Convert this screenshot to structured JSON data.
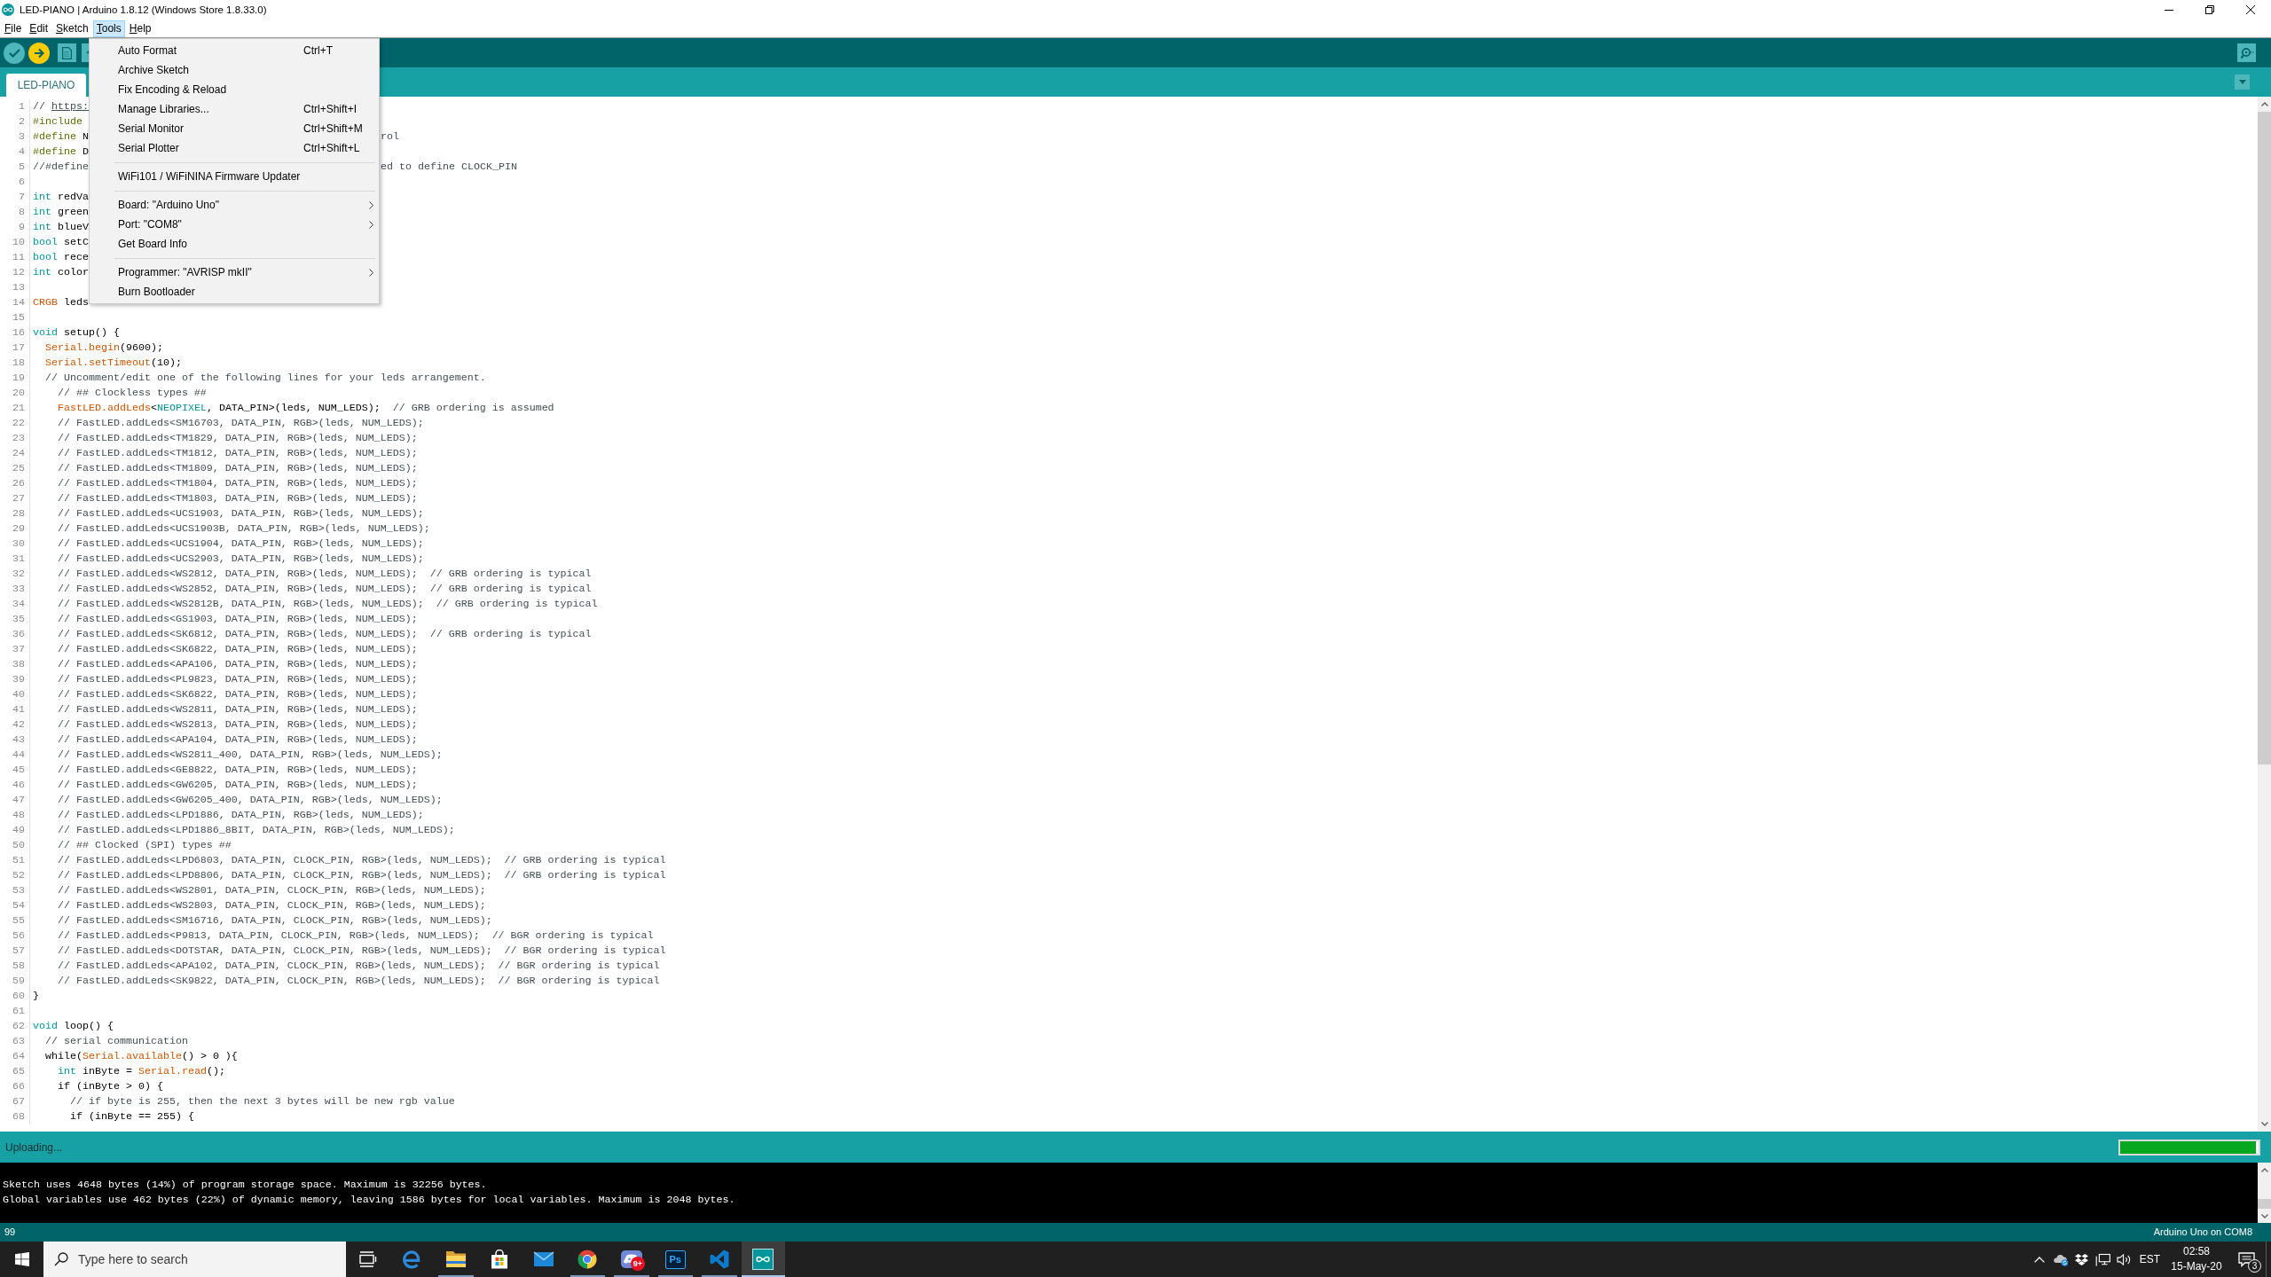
{
  "window": {
    "title": "LED-PIANO | Arduino 1.8.12 (Windows Store 1.8.33.0)"
  },
  "menu_bar": [
    {
      "label": "File",
      "selected": false
    },
    {
      "label": "Edit",
      "selected": false
    },
    {
      "label": "Sketch",
      "selected": false
    },
    {
      "label": "Tools",
      "selected": true
    },
    {
      "label": "Help",
      "selected": false
    }
  ],
  "tools_menu": {
    "items": [
      {
        "kind": "item",
        "label": "Auto Format",
        "shortcut": "Ctrl+T"
      },
      {
        "kind": "item",
        "label": "Archive Sketch"
      },
      {
        "kind": "item",
        "label": "Fix Encoding & Reload"
      },
      {
        "kind": "item",
        "label": "Manage Libraries...",
        "shortcut": "Ctrl+Shift+I"
      },
      {
        "kind": "item",
        "label": "Serial Monitor",
        "shortcut": "Ctrl+Shift+M"
      },
      {
        "kind": "item",
        "label": "Serial Plotter",
        "shortcut": "Ctrl+Shift+L"
      },
      {
        "kind": "separator"
      },
      {
        "kind": "item",
        "label": "WiFi101 / WiFiNINA Firmware Updater"
      },
      {
        "kind": "separator"
      },
      {
        "kind": "submenu",
        "label": "Board: \"Arduino Uno\""
      },
      {
        "kind": "submenu",
        "label": "Port: \"COM8\""
      },
      {
        "kind": "item",
        "label": "Get Board Info"
      },
      {
        "kind": "separator"
      },
      {
        "kind": "submenu",
        "label": "Programmer: \"AVRISP mkII\""
      },
      {
        "kind": "item",
        "label": "Burn Bootloader"
      }
    ]
  },
  "tabs": [
    {
      "label": "LED-PIANO",
      "selected": true
    }
  ],
  "editor": {
    "lines": [
      {
        "number": "1",
        "code": [
          {
            "kind": "comment",
            "text": "// "
          },
          {
            "kind": "link",
            "text": "https:"
          }
        ]
      },
      {
        "number": "2",
        "code": [
          {
            "kind": "preprocessor",
            "text": "#include"
          }
        ]
      },
      {
        "number": "3",
        "code": [
          {
            "kind": "preprocessor",
            "text": "#define"
          },
          {
            "kind": "plain",
            "text": " N"
          }
        ],
        "code_after_menu": [
          {
            "kind": "comment",
            "text": "rol"
          }
        ]
      },
      {
        "number": "4",
        "code": [
          {
            "kind": "preprocessor",
            "text": "#define"
          },
          {
            "kind": "plain",
            "text": " D"
          }
        ]
      },
      {
        "number": "5",
        "code": [
          {
            "kind": "comment",
            "text": "//#define"
          }
        ],
        "code_after_menu": [
          {
            "kind": "comment",
            "text": "ed to define CLOCK_PIN"
          }
        ]
      },
      {
        "number": "6"
      },
      {
        "number": "7",
        "code": [
          {
            "kind": "keyword",
            "text": "int"
          },
          {
            "kind": "plain",
            "text": " redVa"
          }
        ]
      },
      {
        "number": "8",
        "code": [
          {
            "kind": "keyword",
            "text": "int"
          },
          {
            "kind": "plain",
            "text": " green"
          }
        ]
      },
      {
        "number": "9",
        "code": [
          {
            "kind": "keyword",
            "text": "int"
          },
          {
            "kind": "plain",
            "text": " blueV"
          }
        ]
      },
      {
        "number": "10",
        "code": [
          {
            "kind": "keyword",
            "text": "bool"
          },
          {
            "kind": "plain",
            "text": " setC"
          }
        ]
      },
      {
        "number": "11",
        "code": [
          {
            "kind": "keyword",
            "text": "bool"
          },
          {
            "kind": "plain",
            "text": " rece"
          }
        ]
      },
      {
        "number": "12",
        "code": [
          {
            "kind": "keyword",
            "text": "int"
          },
          {
            "kind": "plain",
            "text": " color"
          }
        ]
      },
      {
        "number": "13"
      },
      {
        "number": "14",
        "code": [
          {
            "kind": "builtin",
            "text": "CRGB"
          },
          {
            "kind": "plain",
            "text": " leds"
          }
        ]
      },
      {
        "number": "15"
      },
      {
        "number": "16",
        "code": [
          {
            "kind": "keyword",
            "text": "void"
          },
          {
            "kind": "plain",
            "text": " setup() {"
          }
        ]
      },
      {
        "number": "17",
        "code": [
          {
            "kind": "builtin",
            "text": "  Serial.begin"
          },
          {
            "kind": "plain",
            "text": "(9600);"
          }
        ]
      },
      {
        "number": "18",
        "code": [
          {
            "kind": "builtin",
            "text": "  Serial.setTimeout"
          },
          {
            "kind": "plain",
            "text": "(10);"
          }
        ]
      },
      {
        "number": "19",
        "code": [
          {
            "kind": "comment",
            "text": "  // Uncomment/edit one of the following lines for your leds arrangement."
          }
        ]
      },
      {
        "number": "20",
        "code": [
          {
            "kind": "comment",
            "text": "    // ## Clockless types ##"
          }
        ]
      },
      {
        "number": "21",
        "code": [
          {
            "kind": "builtin",
            "text": "    FastLED.addLeds"
          },
          {
            "kind": "plain",
            "text": "<"
          },
          {
            "kind": "keyword",
            "text": "NEOPIXEL"
          },
          {
            "kind": "plain",
            "text": ", DATA_PIN>(leds, NUM_LEDS);  "
          },
          {
            "kind": "comment",
            "text": "// GRB ordering is assumed"
          }
        ]
      },
      {
        "number": "22",
        "code": [
          {
            "kind": "comment",
            "text": "    // FastLED.addLeds<SM16703, DATA_PIN, RGB>(leds, NUM_LEDS);"
          }
        ]
      },
      {
        "number": "23",
        "code": [
          {
            "kind": "comment",
            "text": "    // FastLED.addLeds<TM1829, DATA_PIN, RGB>(leds, NUM_LEDS);"
          }
        ]
      },
      {
        "number": "24",
        "code": [
          {
            "kind": "comment",
            "text": "    // FastLED.addLeds<TM1812, DATA_PIN, RGB>(leds, NUM_LEDS);"
          }
        ]
      },
      {
        "number": "25",
        "code": [
          {
            "kind": "comment",
            "text": "    // FastLED.addLeds<TM1809, DATA_PIN, RGB>(leds, NUM_LEDS);"
          }
        ]
      },
      {
        "number": "26",
        "code": [
          {
            "kind": "comment",
            "text": "    // FastLED.addLeds<TM1804, DATA_PIN, RGB>(leds, NUM_LEDS);"
          }
        ]
      },
      {
        "number": "27",
        "code": [
          {
            "kind": "comment",
            "text": "    // FastLED.addLeds<TM1803, DATA_PIN, RGB>(leds, NUM_LEDS);"
          }
        ]
      },
      {
        "number": "28",
        "code": [
          {
            "kind": "comment",
            "text": "    // FastLED.addLeds<UCS1903, DATA_PIN, RGB>(leds, NUM_LEDS);"
          }
        ]
      },
      {
        "number": "29",
        "code": [
          {
            "kind": "comment",
            "text": "    // FastLED.addLeds<UCS1903B, DATA_PIN, RGB>(leds, NUM_LEDS);"
          }
        ]
      },
      {
        "number": "30",
        "code": [
          {
            "kind": "comment",
            "text": "    // FastLED.addLeds<UCS1904, DATA_PIN, RGB>(leds, NUM_LEDS);"
          }
        ]
      },
      {
        "number": "31",
        "code": [
          {
            "kind": "comment",
            "text": "    // FastLED.addLeds<UCS2903, DATA_PIN, RGB>(leds, NUM_LEDS);"
          }
        ]
      },
      {
        "number": "32",
        "code": [
          {
            "kind": "comment",
            "text": "    // FastLED.addLeds<WS2812, DATA_PIN, RGB>(leds, NUM_LEDS);  // GRB ordering is typical"
          }
        ]
      },
      {
        "number": "33",
        "code": [
          {
            "kind": "comment",
            "text": "    // FastLED.addLeds<WS2852, DATA_PIN, RGB>(leds, NUM_LEDS);  // GRB ordering is typical"
          }
        ]
      },
      {
        "number": "34",
        "code": [
          {
            "kind": "comment",
            "text": "    // FastLED.addLeds<WS2812B, DATA_PIN, RGB>(leds, NUM_LEDS);  // GRB ordering is typical"
          }
        ]
      },
      {
        "number": "35",
        "code": [
          {
            "kind": "comment",
            "text": "    // FastLED.addLeds<GS1903, DATA_PIN, RGB>(leds, NUM_LEDS);"
          }
        ]
      },
      {
        "number": "36",
        "code": [
          {
            "kind": "comment",
            "text": "    // FastLED.addLeds<SK6812, DATA_PIN, RGB>(leds, NUM_LEDS);  // GRB ordering is typical"
          }
        ]
      },
      {
        "number": "37",
        "code": [
          {
            "kind": "comment",
            "text": "    // FastLED.addLeds<SK6822, DATA_PIN, RGB>(leds, NUM_LEDS);"
          }
        ]
      },
      {
        "number": "38",
        "code": [
          {
            "kind": "comment",
            "text": "    // FastLED.addLeds<APA106, DATA_PIN, RGB>(leds, NUM_LEDS);"
          }
        ]
      },
      {
        "number": "39",
        "code": [
          {
            "kind": "comment",
            "text": "    // FastLED.addLeds<PL9823, DATA_PIN, RGB>(leds, NUM_LEDS);"
          }
        ]
      },
      {
        "number": "40",
        "code": [
          {
            "kind": "comment",
            "text": "    // FastLED.addLeds<SK6822, DATA_PIN, RGB>(leds, NUM_LEDS);"
          }
        ]
      },
      {
        "number": "41",
        "code": [
          {
            "kind": "comment",
            "text": "    // FastLED.addLeds<WS2811, DATA_PIN, RGB>(leds, NUM_LEDS);"
          }
        ]
      },
      {
        "number": "42",
        "code": [
          {
            "kind": "comment",
            "text": "    // FastLED.addLeds<WS2813, DATA_PIN, RGB>(leds, NUM_LEDS);"
          }
        ]
      },
      {
        "number": "43",
        "code": [
          {
            "kind": "comment",
            "text": "    // FastLED.addLeds<APA104, DATA_PIN, RGB>(leds, NUM_LEDS);"
          }
        ]
      },
      {
        "number": "44",
        "code": [
          {
            "kind": "comment",
            "text": "    // FastLED.addLeds<WS2811_400, DATA_PIN, RGB>(leds, NUM_LEDS);"
          }
        ]
      },
      {
        "number": "45",
        "code": [
          {
            "kind": "comment",
            "text": "    // FastLED.addLeds<GE8822, DATA_PIN, RGB>(leds, NUM_LEDS);"
          }
        ]
      },
      {
        "number": "46",
        "code": [
          {
            "kind": "comment",
            "text": "    // FastLED.addLeds<GW6205, DATA_PIN, RGB>(leds, NUM_LEDS);"
          }
        ]
      },
      {
        "number": "47",
        "code": [
          {
            "kind": "comment",
            "text": "    // FastLED.addLeds<GW6205_400, DATA_PIN, RGB>(leds, NUM_LEDS);"
          }
        ]
      },
      {
        "number": "48",
        "code": [
          {
            "kind": "comment",
            "text": "    // FastLED.addLeds<LPD1886, DATA_PIN, RGB>(leds, NUM_LEDS);"
          }
        ]
      },
      {
        "number": "49",
        "code": [
          {
            "kind": "comment",
            "text": "    // FastLED.addLeds<LPD1886_8BIT, DATA_PIN, RGB>(leds, NUM_LEDS);"
          }
        ]
      },
      {
        "number": "50",
        "code": [
          {
            "kind": "comment",
            "text": "    // ## Clocked (SPI) types ##"
          }
        ]
      },
      {
        "number": "51",
        "code": [
          {
            "kind": "comment",
            "text": "    // FastLED.addLeds<LPD6803, DATA_PIN, CLOCK_PIN, RGB>(leds, NUM_LEDS);  // GRB ordering is typical"
          }
        ]
      },
      {
        "number": "52",
        "code": [
          {
            "kind": "comment",
            "text": "    // FastLED.addLeds<LPD8806, DATA_PIN, CLOCK_PIN, RGB>(leds, NUM_LEDS);  // GRB ordering is typical"
          }
        ]
      },
      {
        "number": "53",
        "code": [
          {
            "kind": "comment",
            "text": "    // FastLED.addLeds<WS2801, DATA_PIN, CLOCK_PIN, RGB>(leds, NUM_LEDS);"
          }
        ]
      },
      {
        "number": "54",
        "code": [
          {
            "kind": "comment",
            "text": "    // FastLED.addLeds<WS2803, DATA_PIN, CLOCK_PIN, RGB>(leds, NUM_LEDS);"
          }
        ]
      },
      {
        "number": "55",
        "code": [
          {
            "kind": "comment",
            "text": "    // FastLED.addLeds<SM16716, DATA_PIN, CLOCK_PIN, RGB>(leds, NUM_LEDS);"
          }
        ]
      },
      {
        "number": "56",
        "code": [
          {
            "kind": "comment",
            "text": "    // FastLED.addLeds<P9813, DATA_PIN, CLOCK_PIN, RGB>(leds, NUM_LEDS);  // BGR ordering is typical"
          }
        ]
      },
      {
        "number": "57",
        "code": [
          {
            "kind": "comment",
            "text": "    // FastLED.addLeds<DOTSTAR, DATA_PIN, CLOCK_PIN, RGB>(leds, NUM_LEDS);  // BGR ordering is typical"
          }
        ]
      },
      {
        "number": "58",
        "code": [
          {
            "kind": "comment",
            "text": "    // FastLED.addLeds<APA102, DATA_PIN, CLOCK_PIN, RGB>(leds, NUM_LEDS);  // BGR ordering is typical"
          }
        ]
      },
      {
        "number": "59",
        "code": [
          {
            "kind": "comment",
            "text": "    // FastLED.addLeds<SK9822, DATA_PIN, CLOCK_PIN, RGB>(leds, NUM_LEDS);  // BGR ordering is typical"
          }
        ]
      },
      {
        "number": "60",
        "code": [
          {
            "kind": "plain",
            "text": "}"
          }
        ]
      },
      {
        "number": "61"
      },
      {
        "number": "62",
        "code": [
          {
            "kind": "keyword",
            "text": "void"
          },
          {
            "kind": "plain",
            "text": " loop() {"
          }
        ]
      },
      {
        "number": "63",
        "code": [
          {
            "kind": "comment",
            "text": "  // serial communication"
          }
        ]
      },
      {
        "number": "64",
        "code": [
          {
            "kind": "plain",
            "text": "  while("
          },
          {
            "kind": "builtin",
            "text": "Serial.available"
          },
          {
            "kind": "plain",
            "text": "() > 0 ){"
          }
        ]
      },
      {
        "number": "65",
        "code": [
          {
            "kind": "keyword",
            "text": "    int"
          },
          {
            "kind": "plain",
            "text": " inByte = "
          },
          {
            "kind": "builtin",
            "text": "Serial.read"
          },
          {
            "kind": "plain",
            "text": "();"
          }
        ]
      },
      {
        "number": "66",
        "code": [
          {
            "kind": "plain",
            "text": "    if (inByte > 0) {"
          }
        ]
      },
      {
        "number": "67",
        "code": [
          {
            "kind": "comment",
            "text": "      // if byte is 255, then the next 3 bytes will be new rgb value"
          }
        ]
      },
      {
        "number": "68",
        "code": [
          {
            "kind": "plain",
            "text": "      if (inByte == 255) {"
          }
        ]
      }
    ]
  },
  "status": {
    "message": "Uploading...",
    "progress": {
      "level": 0.98
    }
  },
  "console": {
    "lines": [
      "Sketch uses 4648 bytes (14%) of program storage space. Maximum is 32256 bytes.",
      "Global variables use 462 bytes (22%) of dynamic memory, leaving 1586 bytes for local variables. Maximum is 2048 bytes."
    ]
  },
  "footer": {
    "line_number": "99",
    "board": "Arduino Uno on COM8"
  },
  "taskbar": {
    "search": {
      "placeholder": "Type here to search"
    },
    "apps": [
      {
        "kind": "taskview",
        "running": false,
        "selected": false
      },
      {
        "kind": "browser",
        "running": false,
        "selected": false
      },
      {
        "kind": "folder",
        "running": true,
        "selected": false
      },
      {
        "kind": "store",
        "running": false,
        "selected": false
      },
      {
        "kind": "mail",
        "running": false,
        "selected": false
      },
      {
        "kind": "wheel",
        "running": true,
        "selected": false
      },
      {
        "kind": "chat",
        "running": true,
        "selected": false,
        "badge": "9+"
      },
      {
        "kind": "tile",
        "label": "Ps",
        "running": true,
        "selected": false
      },
      {
        "kind": "ribbon",
        "running": true,
        "selected": false
      },
      {
        "kind": "sketch",
        "running": true,
        "selected": true
      }
    ],
    "tray": {
      "language": "EST",
      "time": "02:58",
      "date": "15-May-20",
      "notification_count": "3"
    }
  }
}
